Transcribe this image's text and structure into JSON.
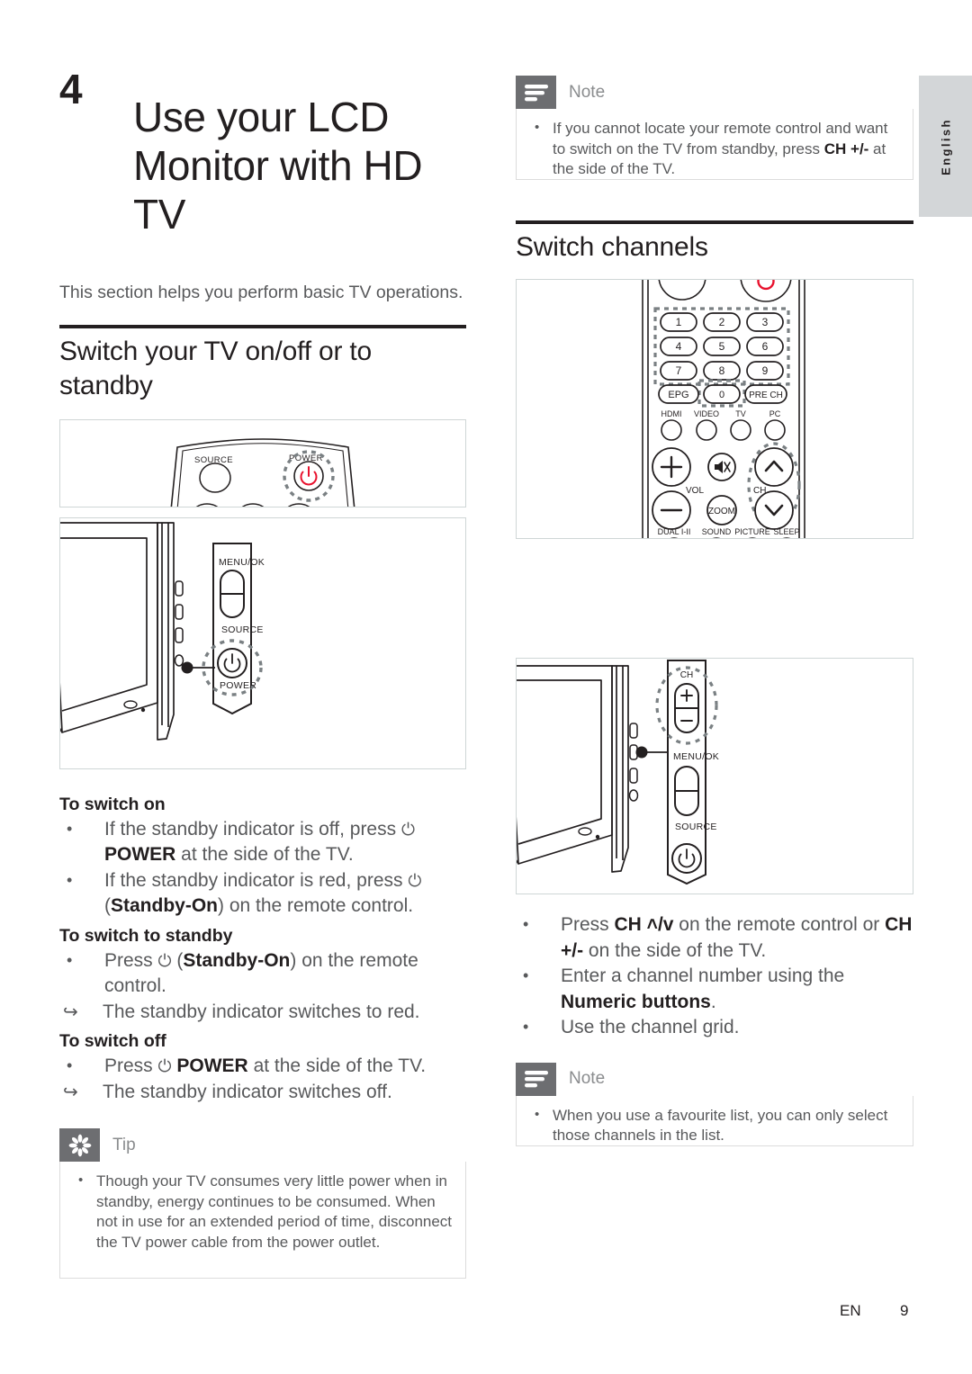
{
  "document": {
    "language_tab": "English",
    "footer": {
      "locale": "EN",
      "page_number": "9"
    }
  },
  "chapter": {
    "number": "4",
    "title": "Use your LCD Monitor with HD TV",
    "intro": "This section helps you perform basic TV operations."
  },
  "left_column": {
    "section_heading": "Switch your TV on/off or to standby",
    "figure_remote_top": {
      "caption_source": "SOURCE",
      "caption_power": "POWER"
    },
    "figure_tv_side": {
      "label_menu_ok": "MENU/OK",
      "label_source": "SOURCE",
      "label_power": "POWER"
    },
    "to_switch_on": {
      "heading": "To switch on",
      "bullets": [
        {
          "pre": "If the standby indicator is off, press ",
          "glyph": "⏻",
          "post": " ",
          "bold": "POWER",
          "tail": " at the side of the TV."
        },
        {
          "pre": "If the standby indicator is red, press ",
          "glyph": "⏻",
          "post": " (",
          "bold": "Standby-On",
          "tail": ") on the remote control."
        }
      ]
    },
    "to_switch_standby": {
      "heading": "To switch to standby",
      "bullets": [
        {
          "pre": "Press ",
          "glyph": "⏻",
          "post": " (",
          "bold": "Standby-On",
          "tail": ") on the remote control."
        }
      ],
      "result": "The standby indicator switches to red."
    },
    "to_switch_off": {
      "heading": "To switch off",
      "bullets": [
        {
          "pre": "Press ",
          "glyph": "⏻",
          "post": " ",
          "bold": "POWER",
          "tail": " at the side of the TV."
        }
      ],
      "result": "The standby indicator switches off."
    },
    "tip": {
      "label": "Tip",
      "icon": "asterisk-burst-icon",
      "items": [
        "Though your TV consumes very little power when in standby, energy continues to be consumed. When not in use for an extended period of time, disconnect the TV power cable from the power outlet."
      ]
    }
  },
  "right_column": {
    "note_top": {
      "label": "Note",
      "icon": "note-lines-icon",
      "item": {
        "pre": "If you cannot locate your remote control and want to switch on the TV from standby, press ",
        "bold": "CH +/-",
        "tail": " at the side of the TV."
      }
    },
    "section_heading": "Switch channels",
    "figure_remote": {
      "numeric_buttons": [
        "1",
        "2",
        "3",
        "4",
        "5",
        "6",
        "7",
        "8",
        "9"
      ],
      "extra_buttons": [
        "EPG",
        "0",
        "PRE CH"
      ],
      "source_labels": [
        "HDMI",
        "VIDEO",
        "TV",
        "PC"
      ],
      "vol_label": "VOL",
      "ch_label": "CH",
      "zoom_label": "ZOOM",
      "bottom_labels": [
        "DUAL I-II",
        "SOUND",
        "PICTURE",
        "SLEEP"
      ],
      "power_icon": "power-icon",
      "mute_icon": "mute-icon"
    },
    "figure_tv_side": {
      "label_ch": "CH",
      "label_plus": "+",
      "label_minus": "–",
      "label_menu_ok": "MENU/OK",
      "label_source": "SOURCE"
    },
    "bullets": [
      {
        "pre": "Press ",
        "bold": "CH ˄/ᴠ",
        "tail1": " on the remote control or ",
        "bold2": "CH +/-",
        "tail2": " on the side of the TV."
      },
      {
        "pre": "Enter a channel number using the ",
        "bold": "Numeric buttons",
        "tail1": "."
      },
      {
        "pre": "Use the channel grid.",
        "bold": "",
        "tail1": ""
      }
    ],
    "note_bottom": {
      "label": "Note",
      "icon": "note-lines-icon",
      "item": "When you use a favourite list, you can only select those channels in the list."
    }
  },
  "colors": {
    "text": "#231f20",
    "body_text": "#58595b",
    "callout_icon_bg": "#6d6e71",
    "callout_label": "#8a8c8e",
    "lang_tab_bg": "#d3d6d8",
    "power_red": "#e8112d",
    "figure_border": "#cfd6d6"
  }
}
